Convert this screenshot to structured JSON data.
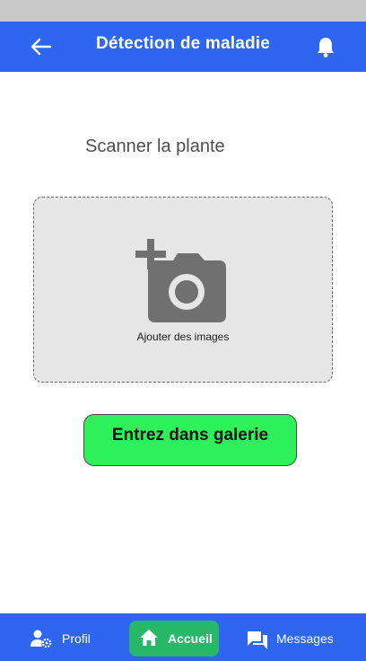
{
  "header": {
    "title": "Détection de maladie",
    "back_icon": "arrow-left-icon",
    "notification_icon": "bell-icon"
  },
  "main": {
    "scan_label": "Scanner la plante",
    "upload": {
      "icon": "add-a-photo-icon",
      "caption": "Ajouter des images"
    },
    "gallery_button_label": "Entrez dans galerie"
  },
  "bottom_nav": {
    "items": [
      {
        "label": "Profil",
        "icon": "person-settings-icon"
      },
      {
        "label": "Accueil",
        "icon": "home-icon",
        "active": true
      },
      {
        "label": "Messages",
        "icon": "chat-icon"
      }
    ]
  },
  "colors": {
    "primary": "#2e66f0",
    "active_nav": "#27b86a",
    "gallery_button": "#2ef05a",
    "status_bar": "#c8c8c8"
  }
}
